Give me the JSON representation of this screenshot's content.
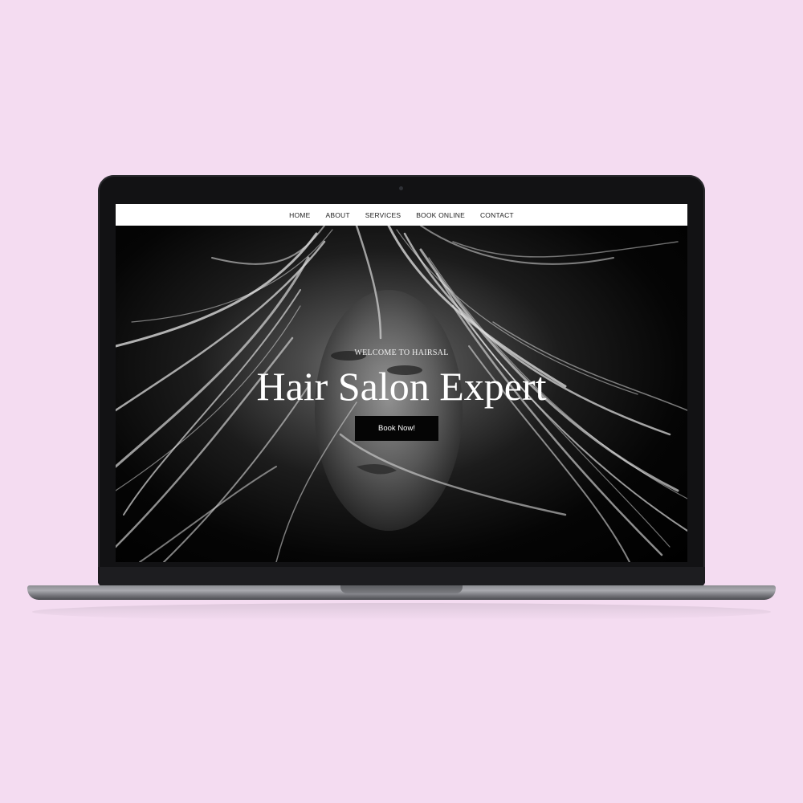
{
  "nav": {
    "items": [
      {
        "label": "HOME"
      },
      {
        "label": "ABOUT"
      },
      {
        "label": "SERVICES"
      },
      {
        "label": "BOOK ONLINE"
      },
      {
        "label": "CONTACT"
      }
    ]
  },
  "hero": {
    "kicker": "WELCOME TO HAIRSAL",
    "title": "Hair Salon Expert",
    "button_label": "Book Now!"
  },
  "colors": {
    "background": "#f4dcf1",
    "nav_background": "#ffffff",
    "button_background": "#050505"
  }
}
